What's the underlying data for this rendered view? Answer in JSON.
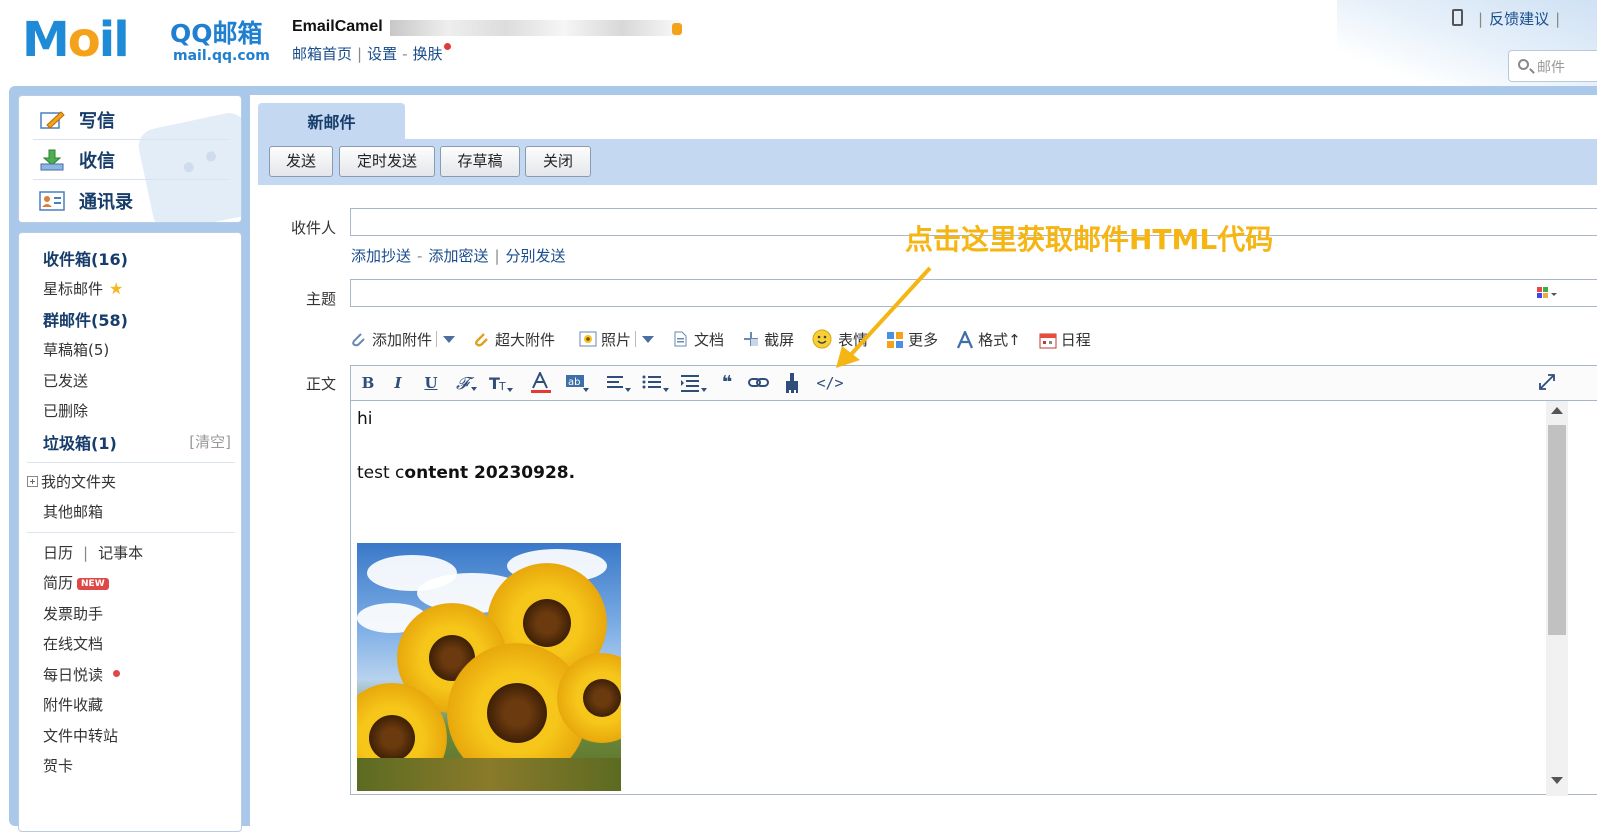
{
  "header": {
    "logo_text": "MOIL",
    "logo_qq": "QQ邮箱",
    "logo_domain": "mail.qq.com",
    "account_name": "EmailCamel",
    "nav": [
      "邮箱首页",
      "设置",
      "换肤"
    ],
    "feedback": "反馈建议",
    "search_placeholder": "邮件"
  },
  "sidebar": {
    "actions": [
      {
        "label": "写信",
        "icon": "write-icon"
      },
      {
        "label": "收信",
        "icon": "inbox-download-icon"
      },
      {
        "label": "通讯录",
        "icon": "contacts-icon"
      }
    ],
    "folders": {
      "inbox": "收件箱(16)",
      "starred": "星标邮件",
      "group": "群邮件(58)",
      "drafts": "草稿箱(5)",
      "sent": "已发送",
      "deleted": "已删除",
      "spam": "垃圾箱(1)",
      "spam_clear": "[清空]",
      "my_folders": "我的文件夹",
      "other_mailbox": "其他邮箱"
    },
    "tools": {
      "calendar": "日历",
      "notes": "记事本",
      "resume": "简历",
      "resume_badge": "NEW",
      "invoice": "发票助手",
      "online_docs": "在线文档",
      "daily_read": "每日悦读",
      "attachments": "附件收藏",
      "transfer": "文件中转站",
      "cards": "贺卡"
    }
  },
  "compose": {
    "tab": "新邮件",
    "buttons": [
      "发送",
      "定时发送",
      "存草稿",
      "关闭"
    ],
    "recipient_label": "收件人",
    "recipient_links": [
      "添加抄送",
      "添加密送",
      "分别发送"
    ],
    "subject_label": "主题",
    "body_label": "正文",
    "attach_items": [
      "添加附件",
      "超大附件",
      "照片",
      "文档",
      "截屏",
      "表情",
      "更多",
      "格式↑",
      "日程"
    ],
    "editor_tools": [
      "B",
      "I",
      "U",
      "</>"
    ],
    "body_line1": "hi",
    "body_line2_prefix": "test c",
    "body_line2_bold": "ontent 20230928."
  },
  "annotation": "点击这里获取邮件HTML代码",
  "colors": {
    "brand_blue": "#1f8ad6",
    "frame_blue": "#a9c8ea",
    "annotation_yellow": "#f5b512"
  }
}
